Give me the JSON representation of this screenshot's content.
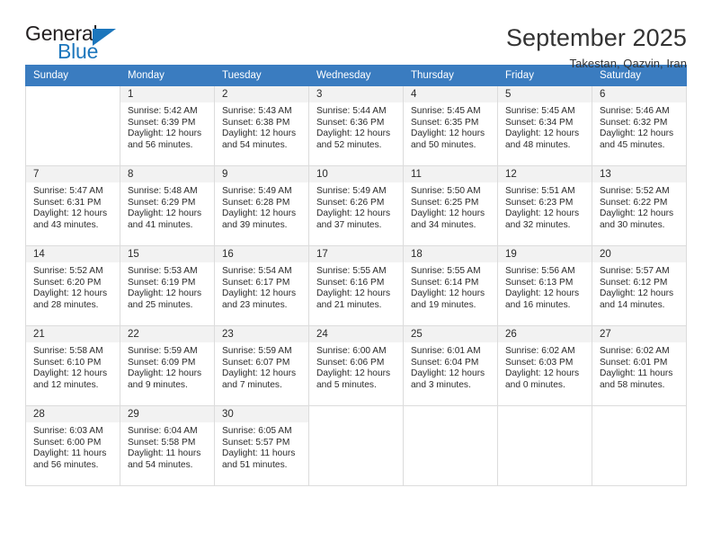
{
  "logo": {
    "general": "General",
    "blue": "Blue",
    "triangle_color": "#1c76bc"
  },
  "header": {
    "title": "September 2025",
    "subtitle": "Takestan, Qazvin, Iran"
  },
  "theme": {
    "header_bg": "#3a7cc0",
    "header_text": "#ffffff",
    "daynum_bg": "#f2f2f2",
    "grid_border": "#dcdcdc"
  },
  "columns": [
    "Sunday",
    "Monday",
    "Tuesday",
    "Wednesday",
    "Thursday",
    "Friday",
    "Saturday"
  ],
  "labels": {
    "sunrise": "Sunrise:",
    "sunset": "Sunset:",
    "daylight": "Daylight:"
  },
  "weeks": [
    [
      {
        "day": "",
        "sunrise": "",
        "sunset": "",
        "daylight_line1": "",
        "daylight_line2": "",
        "empty": true
      },
      {
        "day": "1",
        "sunrise": "Sunrise: 5:42 AM",
        "sunset": "Sunset: 6:39 PM",
        "daylight_line1": "Daylight: 12 hours",
        "daylight_line2": "and 56 minutes."
      },
      {
        "day": "2",
        "sunrise": "Sunrise: 5:43 AM",
        "sunset": "Sunset: 6:38 PM",
        "daylight_line1": "Daylight: 12 hours",
        "daylight_line2": "and 54 minutes."
      },
      {
        "day": "3",
        "sunrise": "Sunrise: 5:44 AM",
        "sunset": "Sunset: 6:36 PM",
        "daylight_line1": "Daylight: 12 hours",
        "daylight_line2": "and 52 minutes."
      },
      {
        "day": "4",
        "sunrise": "Sunrise: 5:45 AM",
        "sunset": "Sunset: 6:35 PM",
        "daylight_line1": "Daylight: 12 hours",
        "daylight_line2": "and 50 minutes."
      },
      {
        "day": "5",
        "sunrise": "Sunrise: 5:45 AM",
        "sunset": "Sunset: 6:34 PM",
        "daylight_line1": "Daylight: 12 hours",
        "daylight_line2": "and 48 minutes."
      },
      {
        "day": "6",
        "sunrise": "Sunrise: 5:46 AM",
        "sunset": "Sunset: 6:32 PM",
        "daylight_line1": "Daylight: 12 hours",
        "daylight_line2": "and 45 minutes."
      }
    ],
    [
      {
        "day": "7",
        "sunrise": "Sunrise: 5:47 AM",
        "sunset": "Sunset: 6:31 PM",
        "daylight_line1": "Daylight: 12 hours",
        "daylight_line2": "and 43 minutes."
      },
      {
        "day": "8",
        "sunrise": "Sunrise: 5:48 AM",
        "sunset": "Sunset: 6:29 PM",
        "daylight_line1": "Daylight: 12 hours",
        "daylight_line2": "and 41 minutes."
      },
      {
        "day": "9",
        "sunrise": "Sunrise: 5:49 AM",
        "sunset": "Sunset: 6:28 PM",
        "daylight_line1": "Daylight: 12 hours",
        "daylight_line2": "and 39 minutes."
      },
      {
        "day": "10",
        "sunrise": "Sunrise: 5:49 AM",
        "sunset": "Sunset: 6:26 PM",
        "daylight_line1": "Daylight: 12 hours",
        "daylight_line2": "and 37 minutes."
      },
      {
        "day": "11",
        "sunrise": "Sunrise: 5:50 AM",
        "sunset": "Sunset: 6:25 PM",
        "daylight_line1": "Daylight: 12 hours",
        "daylight_line2": "and 34 minutes."
      },
      {
        "day": "12",
        "sunrise": "Sunrise: 5:51 AM",
        "sunset": "Sunset: 6:23 PM",
        "daylight_line1": "Daylight: 12 hours",
        "daylight_line2": "and 32 minutes."
      },
      {
        "day": "13",
        "sunrise": "Sunrise: 5:52 AM",
        "sunset": "Sunset: 6:22 PM",
        "daylight_line1": "Daylight: 12 hours",
        "daylight_line2": "and 30 minutes."
      }
    ],
    [
      {
        "day": "14",
        "sunrise": "Sunrise: 5:52 AM",
        "sunset": "Sunset: 6:20 PM",
        "daylight_line1": "Daylight: 12 hours",
        "daylight_line2": "and 28 minutes."
      },
      {
        "day": "15",
        "sunrise": "Sunrise: 5:53 AM",
        "sunset": "Sunset: 6:19 PM",
        "daylight_line1": "Daylight: 12 hours",
        "daylight_line2": "and 25 minutes."
      },
      {
        "day": "16",
        "sunrise": "Sunrise: 5:54 AM",
        "sunset": "Sunset: 6:17 PM",
        "daylight_line1": "Daylight: 12 hours",
        "daylight_line2": "and 23 minutes."
      },
      {
        "day": "17",
        "sunrise": "Sunrise: 5:55 AM",
        "sunset": "Sunset: 6:16 PM",
        "daylight_line1": "Daylight: 12 hours",
        "daylight_line2": "and 21 minutes."
      },
      {
        "day": "18",
        "sunrise": "Sunrise: 5:55 AM",
        "sunset": "Sunset: 6:14 PM",
        "daylight_line1": "Daylight: 12 hours",
        "daylight_line2": "and 19 minutes."
      },
      {
        "day": "19",
        "sunrise": "Sunrise: 5:56 AM",
        "sunset": "Sunset: 6:13 PM",
        "daylight_line1": "Daylight: 12 hours",
        "daylight_line2": "and 16 minutes."
      },
      {
        "day": "20",
        "sunrise": "Sunrise: 5:57 AM",
        "sunset": "Sunset: 6:12 PM",
        "daylight_line1": "Daylight: 12 hours",
        "daylight_line2": "and 14 minutes."
      }
    ],
    [
      {
        "day": "21",
        "sunrise": "Sunrise: 5:58 AM",
        "sunset": "Sunset: 6:10 PM",
        "daylight_line1": "Daylight: 12 hours",
        "daylight_line2": "and 12 minutes."
      },
      {
        "day": "22",
        "sunrise": "Sunrise: 5:59 AM",
        "sunset": "Sunset: 6:09 PM",
        "daylight_line1": "Daylight: 12 hours",
        "daylight_line2": "and 9 minutes."
      },
      {
        "day": "23",
        "sunrise": "Sunrise: 5:59 AM",
        "sunset": "Sunset: 6:07 PM",
        "daylight_line1": "Daylight: 12 hours",
        "daylight_line2": "and 7 minutes."
      },
      {
        "day": "24",
        "sunrise": "Sunrise: 6:00 AM",
        "sunset": "Sunset: 6:06 PM",
        "daylight_line1": "Daylight: 12 hours",
        "daylight_line2": "and 5 minutes."
      },
      {
        "day": "25",
        "sunrise": "Sunrise: 6:01 AM",
        "sunset": "Sunset: 6:04 PM",
        "daylight_line1": "Daylight: 12 hours",
        "daylight_line2": "and 3 minutes."
      },
      {
        "day": "26",
        "sunrise": "Sunrise: 6:02 AM",
        "sunset": "Sunset: 6:03 PM",
        "daylight_line1": "Daylight: 12 hours",
        "daylight_line2": "and 0 minutes."
      },
      {
        "day": "27",
        "sunrise": "Sunrise: 6:02 AM",
        "sunset": "Sunset: 6:01 PM",
        "daylight_line1": "Daylight: 11 hours",
        "daylight_line2": "and 58 minutes."
      }
    ],
    [
      {
        "day": "28",
        "sunrise": "Sunrise: 6:03 AM",
        "sunset": "Sunset: 6:00 PM",
        "daylight_line1": "Daylight: 11 hours",
        "daylight_line2": "and 56 minutes."
      },
      {
        "day": "29",
        "sunrise": "Sunrise: 6:04 AM",
        "sunset": "Sunset: 5:58 PM",
        "daylight_line1": "Daylight: 11 hours",
        "daylight_line2": "and 54 minutes."
      },
      {
        "day": "30",
        "sunrise": "Sunrise: 6:05 AM",
        "sunset": "Sunset: 5:57 PM",
        "daylight_line1": "Daylight: 11 hours",
        "daylight_line2": "and 51 minutes."
      },
      {
        "day": "",
        "sunrise": "",
        "sunset": "",
        "daylight_line1": "",
        "daylight_line2": "",
        "empty": true
      },
      {
        "day": "",
        "sunrise": "",
        "sunset": "",
        "daylight_line1": "",
        "daylight_line2": "",
        "empty": true
      },
      {
        "day": "",
        "sunrise": "",
        "sunset": "",
        "daylight_line1": "",
        "daylight_line2": "",
        "empty": true
      },
      {
        "day": "",
        "sunrise": "",
        "sunset": "",
        "daylight_line1": "",
        "daylight_line2": "",
        "empty": true
      }
    ]
  ]
}
